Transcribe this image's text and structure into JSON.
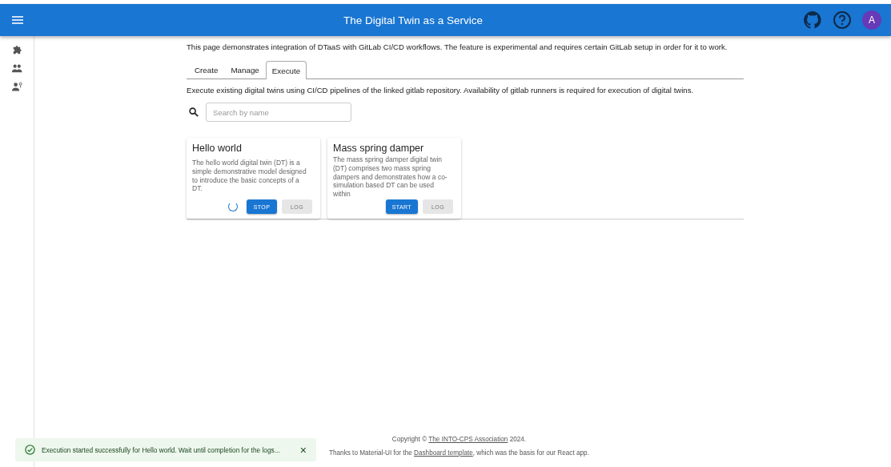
{
  "app_bar": {
    "title": "The Digital Twin as a Service",
    "avatar": "A"
  },
  "sidebar": {
    "items": [
      {
        "kind": "puzzle"
      },
      {
        "kind": "people"
      },
      {
        "kind": "user-gear"
      }
    ]
  },
  "intro": "This page demonstrates integration of DTaaS with GitLab CI/CD workflows. The feature is experimental and requires certain GitLab setup in order for it to work.",
  "tabs": [
    {
      "label": "Create",
      "selected": false
    },
    {
      "label": "Manage",
      "selected": false
    },
    {
      "label": "Execute",
      "selected": true
    }
  ],
  "description": "Execute existing digital twins using CI/CD pipelines of the linked gitlab repository. Availability of gitlab runners is required for execution of digital twins.",
  "search": {
    "placeholder": "Search by name"
  },
  "cards": [
    {
      "title": "Hello world",
      "text": "The hello world digital twin (DT) is a simple demonstrative model designed to introduce the basic concepts of a DT.",
      "running": true,
      "buttons": [
        {
          "label": "STOP",
          "disabled": false
        },
        {
          "label": "LOG",
          "disabled": true
        }
      ]
    },
    {
      "title": "Mass spring damper",
      "text": "The mass spring damper digital twin (DT) comprises two mass spring dampers and demonstrates how a co-simulation based DT can be used within",
      "running": false,
      "buttons": [
        {
          "label": "START",
          "disabled": false
        },
        {
          "label": "LOG",
          "disabled": true
        }
      ]
    }
  ],
  "snackbar": {
    "message": "Execution started successfully for Hello world. Wait until completion for the logs...",
    "close": "×"
  },
  "footer": {
    "copyright_prefix": "Copyright © ",
    "copyright_link": "The INTO-CPS Association",
    "copyright_suffix": " 2024.",
    "thanks_prefix": "Thanks to Material-UI for the ",
    "thanks_link": "Dashboard template",
    "thanks_suffix": ", which was the basis for our React app."
  }
}
